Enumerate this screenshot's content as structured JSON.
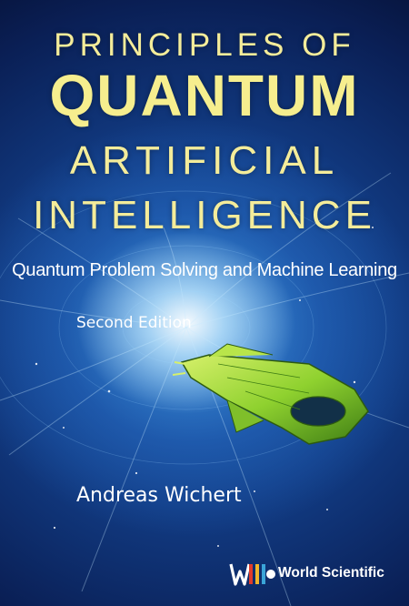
{
  "book": {
    "title_line1": "PRINCIPLES OF",
    "title_line2": "QUANTUM",
    "title_line3": "ARTIFICIAL",
    "title_line4": "INTELLIGENCE",
    "subtitle": "Quantum Problem Solving and Machine Learning",
    "edition": "Second Edition",
    "author": "Andreas Wichert",
    "publisher": "World Scientific"
  },
  "colors": {
    "title": "#f4ec9a",
    "background_center": "#1f5fb2",
    "background_edge": "#050d2c",
    "ship": "#8fd12f"
  },
  "icons": {
    "publisher_logo": "world-scientific-logo-icon",
    "spaceship": "spaceship-illustration"
  }
}
